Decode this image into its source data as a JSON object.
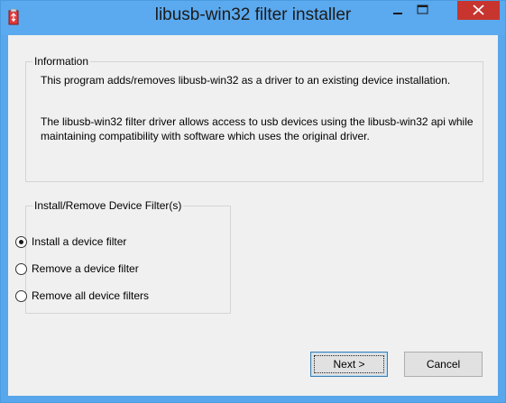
{
  "window": {
    "title": "libusb-win32 filter installer",
    "accent_color": "#5ba9ee",
    "close_button_color": "#c7352e",
    "icons": [
      "app-icon",
      "minimize-icon",
      "maximize-icon",
      "close-icon"
    ]
  },
  "information": {
    "group_title": "Information",
    "paragraph1": "This program adds/removes libusb-win32 as a driver to an existing device installation.",
    "paragraph2": "The libusb-win32 filter driver allows access to usb devices using the libusb-win32 api while maintaining compatibility with software which uses the original driver."
  },
  "install_group": {
    "group_title": "Install/Remove Device Filter(s)",
    "options": [
      {
        "label": "Install a device filter",
        "selected": true
      },
      {
        "label": "Remove a device filter",
        "selected": false
      },
      {
        "label": "Remove all device filters",
        "selected": false
      }
    ]
  },
  "buttons": {
    "next_label": "Next >",
    "cancel_label": "Cancel"
  }
}
